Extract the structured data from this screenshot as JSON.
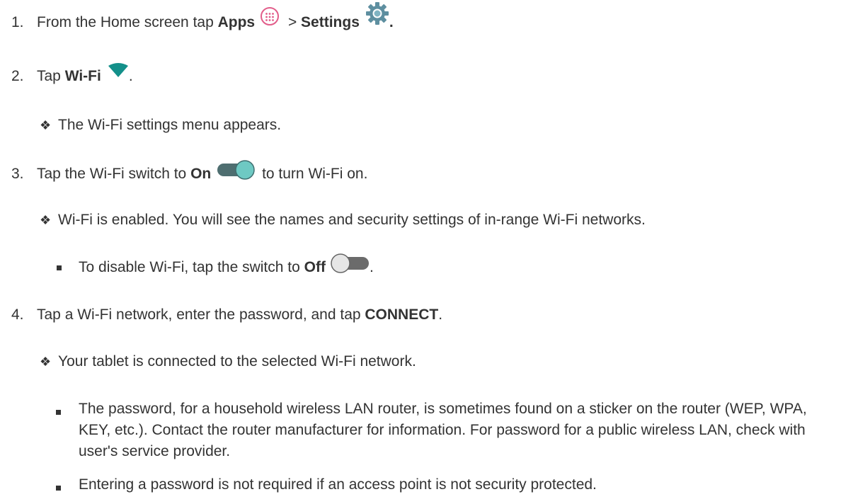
{
  "steps": [
    {
      "number": "1.",
      "text_a": "From the Home screen tap ",
      "bold_a": "Apps",
      "text_b": " > ",
      "bold_b": "Settings",
      "text_c": "."
    },
    {
      "number": "2.",
      "text_a": "Tap ",
      "bold_a": "Wi-Fi",
      "text_b": "."
    },
    {
      "number": "3.",
      "text_a": "Tap the Wi-Fi switch to ",
      "bold_a": "On",
      "text_b": " to turn Wi-Fi on."
    },
    {
      "number": "4.",
      "text_a": "Tap a Wi-Fi network, enter the password, and tap ",
      "bold_a": "CONNECT",
      "text_b": "."
    }
  ],
  "notes": {
    "menu_appears": "The Wi-Fi settings menu appears.",
    "wifi_enabled": "Wi-Fi is enabled. You will see the names and security settings of in-range Wi-Fi networks.",
    "disable_a": "To disable Wi-Fi, tap the switch to ",
    "disable_bold": "Off",
    "disable_b": ".",
    "connected": "Your tablet is connected to the selected Wi-Fi network.",
    "password_info": "The password, for a household wireless LAN router, is sometimes found on a sticker on the router (WEP, WPA, KEY, etc.). Contact the router manufacturer for information. For password for a public wireless LAN, check with user's service provider.",
    "no_password": "Entering a password is not required if an access point is not security protected."
  },
  "bullet_glyph": "❖",
  "icons": {
    "apps": "apps-icon",
    "settings": "settings-gear-icon",
    "wifi": "wifi-icon",
    "switch_on": "switch-on-icon",
    "switch_off": "switch-off-icon"
  },
  "colors": {
    "text": "#333333",
    "apps_icon": "#e25d8a",
    "settings_icon": "#5e8fa0",
    "wifi_icon": "#13908a",
    "switch_on_knob": "#6ec9c3",
    "switch_on_track": "#4e6e70",
    "switch_off_knob": "#e6e6e6",
    "switch_off_track": "#6b6b6b"
  }
}
